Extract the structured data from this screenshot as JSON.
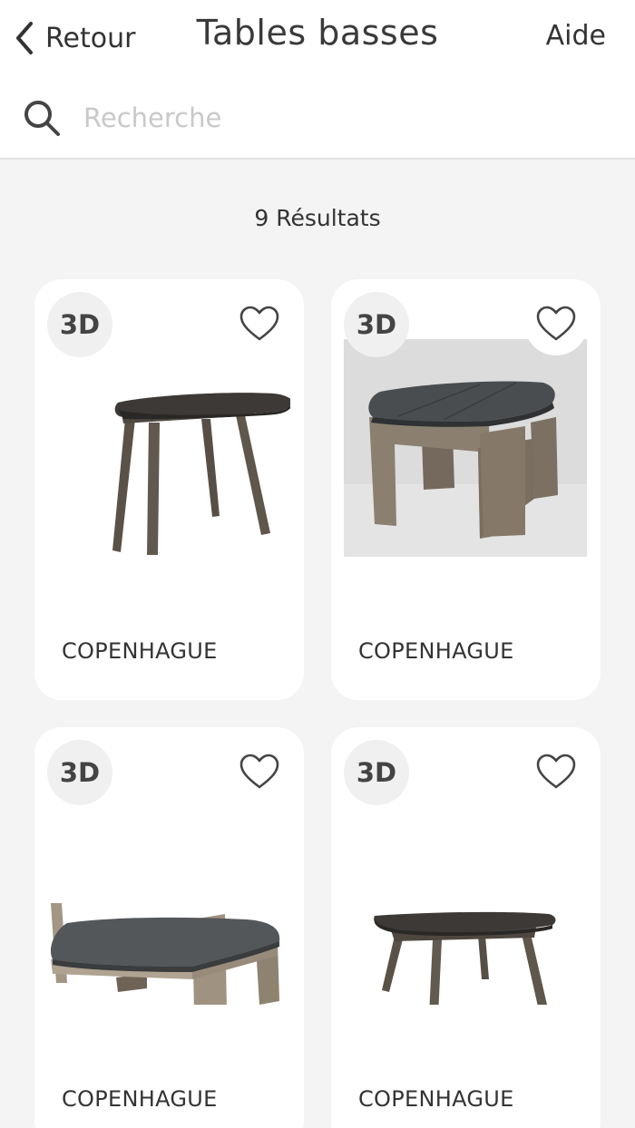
{
  "header": {
    "back_label": "Retour",
    "title": "Tables basses",
    "help_label": "Aide"
  },
  "search": {
    "placeholder": "Recherche",
    "value": ""
  },
  "results_label": "9 Résultats",
  "products": [
    {
      "badge": "3D",
      "name": "COPENHAGUE",
      "image": "side-table-dark-top-slim-legs",
      "favorite": false
    },
    {
      "badge": "3D",
      "name": "COPENHAGUE",
      "image": "side-table-slate-top-wood-base",
      "favorite": false
    },
    {
      "badge": "3D",
      "name": "COPENHAGUE",
      "image": "coffee-table-slate-top-wood-base",
      "favorite": false
    },
    {
      "badge": "3D",
      "name": "COPENHAGUE",
      "image": "coffee-table-dark-top-slim-legs",
      "favorite": false
    }
  ],
  "colors": {
    "background": "#f4f4f4",
    "card": "#ffffff",
    "text": "#333333",
    "placeholder": "#c9c9c9"
  }
}
